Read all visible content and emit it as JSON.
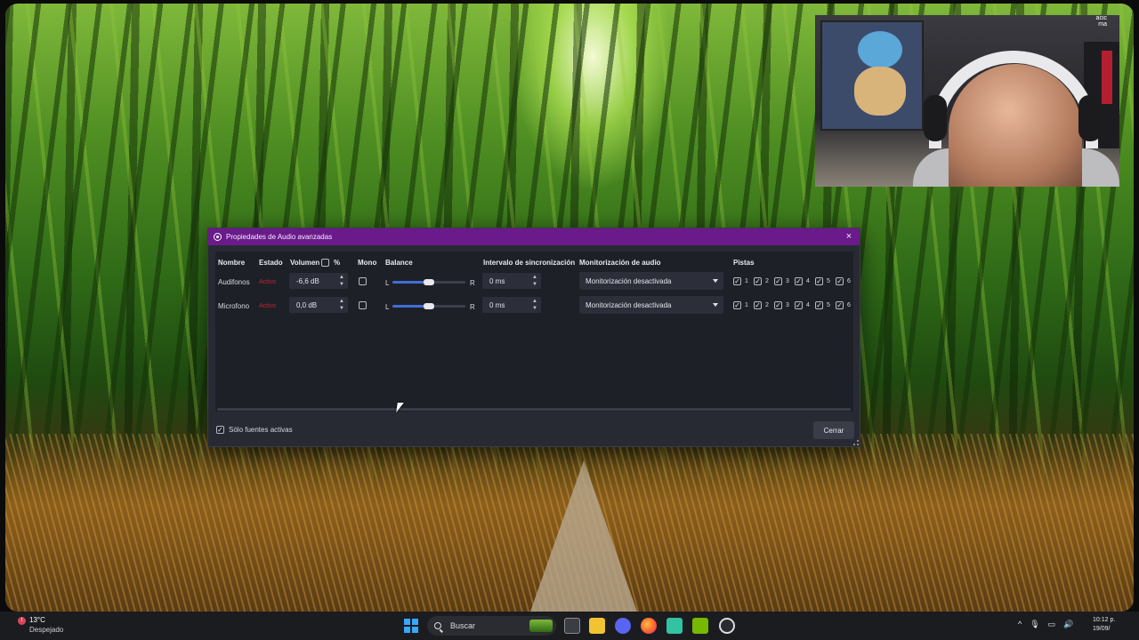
{
  "dialog": {
    "title": "Propiedades de Audio avanzadas",
    "close_glyph": "×",
    "headers": {
      "name": "Nombre",
      "status": "Estado",
      "volume": "Volumen",
      "volume_percent": "%",
      "mono": "Mono",
      "balance": "Balance",
      "sync_offset": "Intervalo de sincronización",
      "monitoring": "Monitorización de audio",
      "tracks": "Pistas"
    },
    "rows": [
      {
        "name": "Audifonos",
        "status": "Activo",
        "volume": "-6,6 dB",
        "mono": false,
        "balance_left": "L",
        "balance_right": "R",
        "balance": 0.5,
        "sync": "0 ms",
        "monitoring": "Monitorización desactivada",
        "tracks": [
          "1",
          "2",
          "3",
          "4",
          "5",
          "6"
        ]
      },
      {
        "name": "Microfono",
        "status": "Activo",
        "volume": "0,0 dB",
        "mono": false,
        "balance_left": "L",
        "balance_right": "R",
        "balance": 0.5,
        "sync": "0 ms",
        "monitoring": "Monitorización desactivada",
        "tracks": [
          "1",
          "2",
          "3",
          "4",
          "5",
          "6"
        ]
      }
    ],
    "only_active_label": "Sólo fuentes activas",
    "only_active_checked": true,
    "close_button": "Cerrar",
    "check_glyph": "✓",
    "spin_up": "▲",
    "spin_down": "▼",
    "accent_color": "#6a1a8a",
    "slider_color": "#3e6fd6",
    "status_color": "#c0262e"
  },
  "taskbar": {
    "weather_temp": "13°C",
    "weather_condition": "Despejado",
    "weather_badge": "!",
    "search_placeholder": "Buscar",
    "clock_time": "10:12 p.",
    "clock_date": "19/09/",
    "tray_expand": "^",
    "icons": [
      "start-icon",
      "search-icon",
      "task-view-icon",
      "file-explorer-icon",
      "discord-icon",
      "firefox-icon",
      "streamlabs-icon",
      "nvidia-icon",
      "obs-icon"
    ]
  },
  "webcam": {
    "corner_text_1": "acic",
    "corner_text_2": "ma"
  }
}
